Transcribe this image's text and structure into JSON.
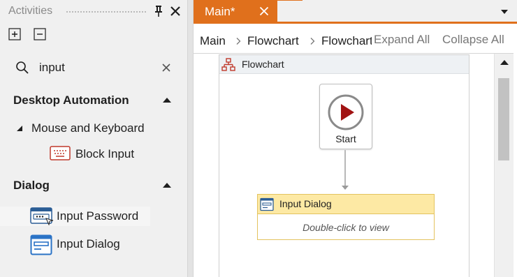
{
  "activities": {
    "title": "Activities",
    "search_value": "input",
    "categories": [
      {
        "label": "Desktop Automation",
        "groups": [
          {
            "label": "Mouse and Keyboard",
            "items": [
              {
                "label": "Block Input",
                "icon": "keyboard-icon"
              }
            ]
          }
        ]
      },
      {
        "label": "Dialog",
        "items": [
          {
            "label": "Input Password",
            "icon": "password-dialog-icon"
          },
          {
            "label": "Input Dialog",
            "icon": "input-dialog-icon"
          }
        ]
      }
    ]
  },
  "designer": {
    "tab_label": "Main*",
    "breadcrumb": [
      "Main",
      "Flowchart",
      "Flowchart"
    ],
    "expand_all": "Expand All",
    "collapse_all": "Collapse All",
    "flowchart": {
      "title": "Flowchart",
      "start_label": "Start",
      "activity": {
        "title": "Input Dialog",
        "hint": "Double-click to view"
      }
    }
  },
  "colors": {
    "accent": "#e0701c",
    "start_red": "#a11313",
    "activity_header": "#fde9a4",
    "activity_border": "#e3c35f"
  }
}
